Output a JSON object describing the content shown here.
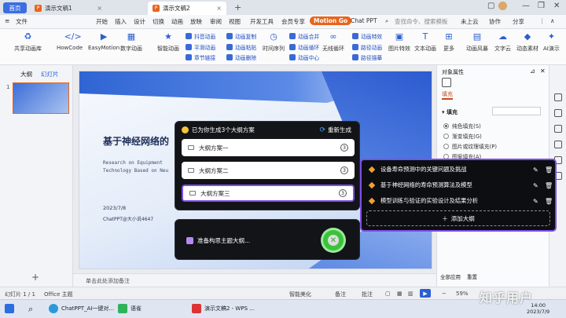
{
  "tabbar": {
    "home": "首页",
    "doc1": "演示文稿1",
    "doc2": "演示文稿2"
  },
  "menubar": {
    "file": "文件",
    "items": [
      "开始",
      "插入",
      "设计",
      "切换",
      "动画",
      "放映",
      "审阅",
      "视图",
      "开发工具",
      "会员专享"
    ],
    "motion_go": "Motion Go",
    "chatppt": "Chat PPT",
    "search_placeholder": "查找命令、搜索模板",
    "sync": "未上云",
    "collab": "协作",
    "share": "分享"
  },
  "toolbar": {
    "big": [
      {
        "icon": "share-anim-icon",
        "label": "共享动画库"
      },
      {
        "icon": "howcode-icon",
        "label": "HowCode"
      },
      {
        "icon": "easymotion-icon",
        "label": "EasyMotion"
      },
      {
        "icon": "digital-anim-icon",
        "label": "数字动画"
      },
      {
        "icon": "smart-anim-icon",
        "label": "智能动画"
      }
    ],
    "col1": [
      "抖音动画",
      "平滑动画",
      "章节链接"
    ],
    "col2": [
      "动画复制",
      "动画粘贴",
      "动画删除"
    ],
    "col3": [
      "时间序列"
    ],
    "col4": [
      "动画合并",
      "动画循环",
      "动画中心"
    ],
    "col5": [
      "无线循环"
    ],
    "col6": [
      "动画特效",
      "路径动画",
      "路径描摹"
    ],
    "col7": [
      "图片特效",
      "文本动画",
      "更多"
    ],
    "right_big": [
      "动画风暴",
      "文字云",
      "动态素材",
      "AI演示"
    ]
  },
  "leftpanel": {
    "tab_outline": "大纲",
    "tab_slides": "幻灯片",
    "slide_num": "1"
  },
  "slide": {
    "title": "基于神经网络的",
    "en_line1": "Research on Equipment",
    "en_line2": "Technology Based on Neu",
    "date": "2023/7/8",
    "author": "ChatPPT@大小说4647"
  },
  "notes": "单击此处添加备注",
  "dialog": {
    "header": "已为你生成3个大纲方案",
    "regenerate": "重新生成",
    "plans": [
      {
        "label": "大纲方案一",
        "count": "3"
      },
      {
        "label": "大纲方案二",
        "count": "3"
      },
      {
        "label": "大纲方案三",
        "count": "3"
      }
    ]
  },
  "dialog2": {
    "text": "准备构思主题大纲..."
  },
  "outline": {
    "items": [
      "设备寿命预测中的关键问题及挑战",
      "基于神经网络的寿命预测算法及模型",
      "模型训练与验证的实验设计及结果分析"
    ],
    "add": "添加大纲"
  },
  "rightpanel": {
    "title": "对象属性",
    "tab": "填充",
    "section": "填充",
    "options": [
      "纯色填充(S)",
      "渐变填充(G)",
      "图片或纹理填充(P)",
      "图案填充(A)"
    ],
    "apply_all": "全部应用",
    "reset": "重置"
  },
  "statusbar": {
    "slide_info": "幻灯片 1 / 1",
    "theme": "Office 主题",
    "beautify": "智能美化",
    "notes": "备注",
    "comments": "批注",
    "zoom": "59%"
  },
  "taskbar": {
    "apps": [
      "ChatPPT_AI一键对...",
      "语雀",
      "演示文稿2 - WPS ..."
    ],
    "time": "14:00",
    "date": "2023/7/9"
  },
  "watermark": "知乎用户",
  "colors": {
    "accent": "#e8641b",
    "primary": "#2c5fd0",
    "purple_border": "#7e4ee8",
    "dark_panel": "#121418"
  }
}
